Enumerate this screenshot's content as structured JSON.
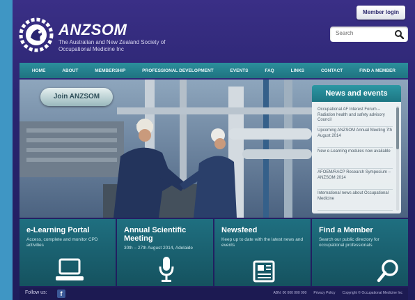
{
  "header": {
    "member_login": "Member login",
    "brand": "ANZSOM",
    "brand_sub": "The Australian and New Zealand Society of Occupational Medicine Inc",
    "search_placeholder": "Search"
  },
  "nav": [
    "HOME",
    "ABOUT",
    "MEMBERSHIP",
    "PROFESSIONAL DEVELOPMENT",
    "EVENTS",
    "FAQ",
    "LINKS",
    "CONTACT",
    "FIND A MEMBER"
  ],
  "hero": {
    "join_label": "Join ANZSOM"
  },
  "news": {
    "title": "News and events",
    "items": [
      "Occupational AF Interest Forum – Radiation health and safety advisory Council",
      "Upcoming ANZSOM Annual Meeting 7th August 2014",
      "New e-Learning modules now available",
      "AFOEM/RACP Research Symposium – ANZSOM 2014",
      "International news about Occupational Medicine"
    ]
  },
  "tiles": [
    {
      "title": "e-Learning Portal",
      "desc": "Access, complete and monitor CPD activities",
      "icon": "laptop-icon"
    },
    {
      "title": "Annual Scientific Meeting",
      "desc": "30th – 27th August 2014, Adelaide",
      "icon": "microphone-icon"
    },
    {
      "title": "Newsfeed",
      "desc": "Keep up to date with the latest news and events",
      "icon": "newspaper-icon"
    },
    {
      "title": "Find a Member",
      "desc": "Search our public directory for occupational professionals",
      "icon": "magnifier-icon"
    }
  ],
  "footer": {
    "follow": "Follow us:",
    "links": [
      "ABN: 00 000 000 000",
      "Privacy Policy",
      "Copyright © Occupational Medicine Inc"
    ]
  },
  "colors": {
    "brand": "#2a2570",
    "nav": "#2b8f9c",
    "accent_bar": "#3f96c4"
  }
}
